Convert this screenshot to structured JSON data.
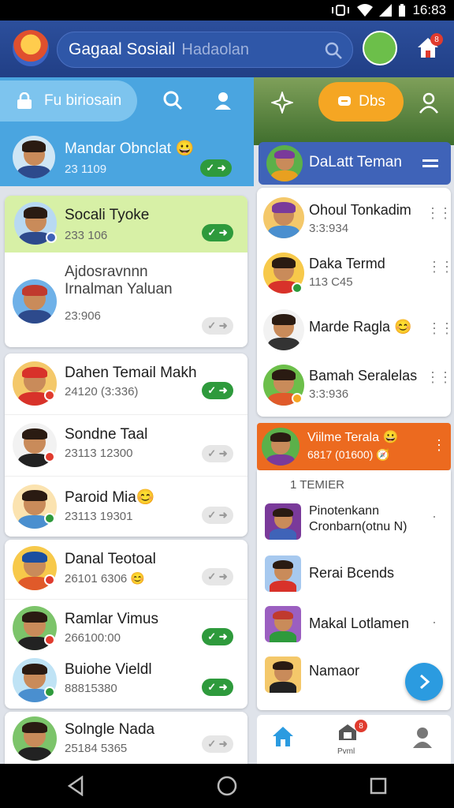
{
  "status": {
    "time": "16:83"
  },
  "search": {
    "title": "Gagaal Sosiail",
    "hint": "Hadaolan"
  },
  "header": {
    "notif_count": "8"
  },
  "left": {
    "tab_label": "Fu biriosain",
    "pinned": {
      "name": "Mandar Obnclat 😀",
      "sub": "23 1109"
    },
    "rows": [
      {
        "name": "Socali Tyoke",
        "sub": "233 106",
        "active": true
      },
      {
        "name": "Ajdosravnnn Irnalman Yaluan",
        "sub": "23:906",
        "active": false
      },
      {
        "name": "Dahen Temail Makh",
        "sub": "24120 (3:336)",
        "active": true
      },
      {
        "name": "Sondne Taal",
        "sub": "23113 12300",
        "active": false
      },
      {
        "name": "Paroid Mia😊",
        "sub": "23113 19301",
        "active": false
      },
      {
        "name": "Danal Teotoal",
        "sub": "26101 6306 😊",
        "active": false
      },
      {
        "name": "Ramlar Vimus",
        "sub": "266100:00",
        "active": true
      },
      {
        "name": "Buiohe Vieldl",
        "sub": "88815380",
        "active": true
      },
      {
        "name": "Solngle Nada",
        "sub": "25184 5365",
        "active": false
      }
    ]
  },
  "right": {
    "tab_label": "Dbs",
    "header": "DaLatt Teman",
    "contacts": [
      {
        "name": "Ohoul Tonkadim",
        "sub": "3:3:934"
      },
      {
        "name": "Daka Termd",
        "sub": "113 C45"
      },
      {
        "name": "Marde Ragla 😊",
        "sub": ""
      },
      {
        "name": "Bamah Seralelas",
        "sub": "3:3:936"
      }
    ],
    "group": {
      "name": "Viilme Terala 😀",
      "sub": "6817 (01600) 🧭"
    },
    "section_label": "1  TEMIER",
    "members": [
      {
        "name": "Pinotenkann Cronbarn(otnu N)"
      },
      {
        "name": "Rerai Bcends"
      },
      {
        "name": "Makal Lotlamen"
      },
      {
        "name": "Namaor"
      }
    ],
    "nav": {
      "middle_label": "Pvml",
      "badge": "8"
    }
  }
}
